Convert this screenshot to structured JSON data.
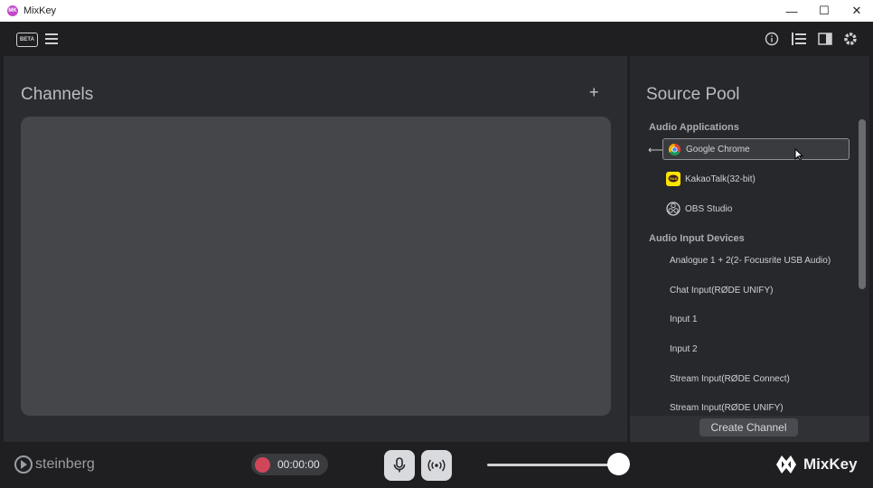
{
  "window": {
    "title": "MixKey",
    "app_icon_text": "MK",
    "controls": {
      "minimize": "—",
      "maximize": "☐",
      "close": "✕"
    }
  },
  "topbar": {
    "beta_label": "BETA",
    "icons": [
      "menu-icon",
      "info-icon",
      "list-icon",
      "sidebar-icon",
      "gear-icon"
    ]
  },
  "channels": {
    "title": "Channels",
    "add_label": "+"
  },
  "source_pool": {
    "title": "Source Pool",
    "apps_label": "Audio Applications",
    "apps": [
      {
        "name": "Google Chrome",
        "icon": "chrome-icon",
        "selected": true
      },
      {
        "name": "KakaoTalk(32-bit)",
        "icon": "kakaotalk-icon",
        "selected": false
      },
      {
        "name": "OBS Studio",
        "icon": "obs-icon",
        "selected": false
      }
    ],
    "devices_label": "Audio Input Devices",
    "devices": [
      "Analogue 1 + 2(2- Focusrite USB Audio)",
      "Chat Input(RØDE UNIFY)",
      "Input 1",
      "Input 2",
      "Stream Input(RØDE Connect)",
      "Stream Input(RØDE UNIFY)"
    ],
    "create_button": "Create Channel"
  },
  "bottombar": {
    "steinberg": "steinberg",
    "record_time": "00:00:00",
    "volume_level": 0.98,
    "brand": "MixKey"
  },
  "colors": {
    "record": "#d2465a",
    "background": "#1f1f22",
    "panel": "#2b2c30"
  }
}
